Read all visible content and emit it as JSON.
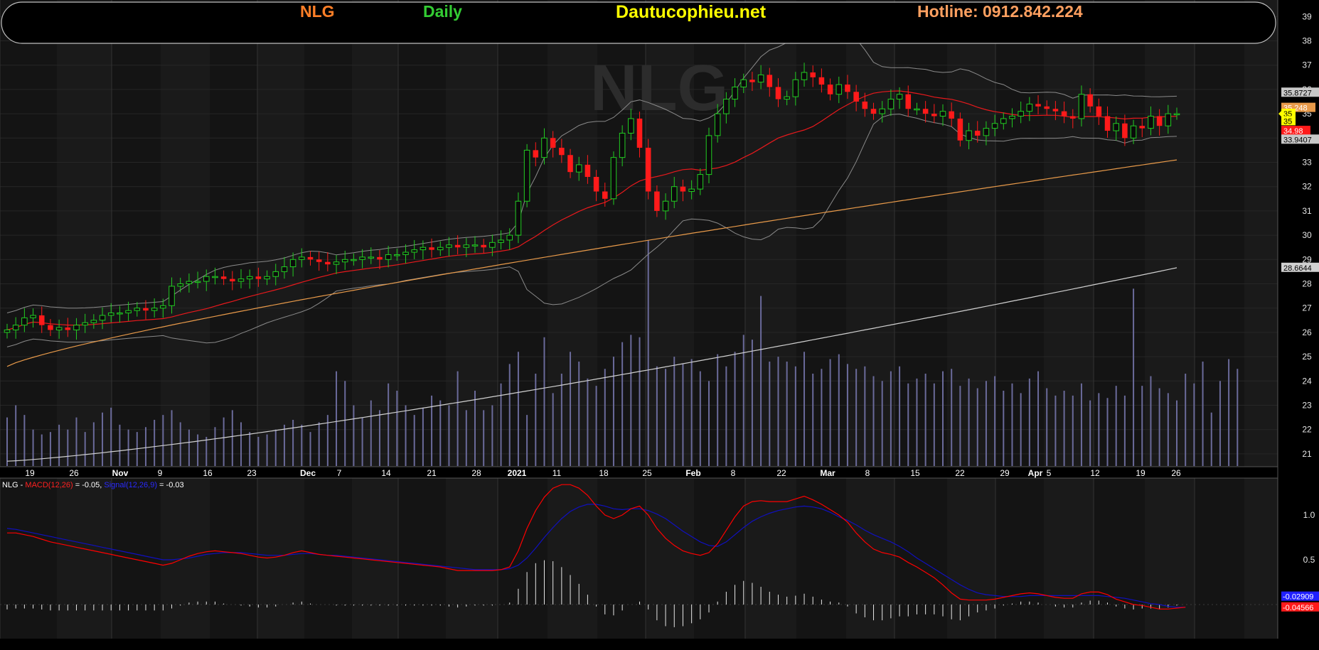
{
  "header": {
    "symbol": "NLG",
    "period": "Daily",
    "site": "Dautucophieu.net",
    "hotline": "Hotline: 0912.842.224"
  },
  "colors": {
    "symbol": "#ff7f27",
    "period": "#33cc33",
    "site": "#ffff00",
    "hotline": "#ffa060",
    "up_candle": "#22cc22",
    "down_candle": "#ff1a1a",
    "ma20": "#e8191c",
    "ma50": "#e89a4a",
    "ma200": "#d0d0d0",
    "bollinger": "#8a8a8a",
    "volume": "#6a6a9a",
    "macd": "#ff0000",
    "signal": "#1010c0",
    "histogram": "#e6e6e6"
  },
  "watermark": "NLG",
  "chart_data": [
    {
      "type": "candlestick",
      "title": "NLG Daily",
      "ylim": [
        20.4,
        39.5
      ],
      "y_ticks": [
        "21",
        "22",
        "23",
        "24",
        "25",
        "26",
        "27",
        "28",
        "29",
        "30",
        "31",
        "32",
        "33",
        "34",
        "35",
        "36",
        "37",
        "38",
        "39"
      ],
      "x_tick_labels": [
        "19",
        "26",
        "Nov",
        "9",
        "16",
        "23",
        "Dec",
        "7",
        "14",
        "21",
        "28",
        "2021",
        "11",
        "18",
        "25",
        "Feb",
        "8",
        "22",
        "Mar",
        "8",
        "15",
        "22",
        "29",
        "Apr",
        "5",
        "12",
        "19",
        "26"
      ],
      "bold_tick_labels": [
        "Nov",
        "Dec",
        "2021",
        "Feb",
        "Mar",
        "Apr"
      ],
      "close": [
        26.1,
        26.3,
        26.6,
        26.7,
        26.3,
        26.1,
        26.2,
        26.1,
        26.3,
        26.4,
        26.5,
        26.7,
        26.8,
        26.8,
        26.9,
        27.0,
        26.9,
        27.0,
        27.1,
        27.9,
        28.0,
        28.1,
        28.1,
        28.3,
        28.3,
        28.2,
        28.1,
        28.2,
        28.3,
        28.2,
        28.3,
        28.5,
        28.7,
        29.0,
        29.1,
        29.0,
        28.9,
        28.8,
        28.9,
        29.0,
        29.0,
        29.1,
        29.1,
        29.0,
        29.2,
        29.2,
        29.3,
        29.4,
        29.5,
        29.4,
        29.5,
        29.6,
        29.5,
        29.6,
        29.6,
        29.5,
        29.7,
        29.8,
        30.0,
        31.4,
        33.5,
        33.2,
        34.0,
        33.6,
        33.3,
        32.6,
        32.9,
        32.4,
        31.8,
        31.5,
        33.2,
        34.2,
        34.8,
        33.6,
        31.8,
        31.0,
        31.4,
        32.0,
        31.8,
        31.9,
        32.5,
        34.1,
        35.0,
        35.6,
        36.1,
        36.4,
        36.3,
        36.6,
        36.1,
        35.6,
        35.7,
        36.4,
        36.7,
        36.5,
        36.2,
        35.8,
        36.2,
        35.9,
        35.5,
        35.2,
        35.0,
        35.2,
        35.6,
        35.8,
        35.2,
        35.2,
        35.0,
        34.9,
        35.1,
        34.8,
        33.9,
        34.3,
        34.1,
        34.4,
        34.6,
        34.8,
        34.9,
        35.1,
        35.4,
        35.3,
        35.2,
        35.1,
        34.9,
        34.8,
        35.8,
        35.3,
        34.9,
        34.3,
        34.6,
        34.0,
        34.5,
        34.4,
        34.9,
        34.5,
        35.0,
        35.0
      ],
      "volume": [
        22.5,
        23.0,
        22.6,
        22.0,
        21.8,
        21.9,
        22.2,
        22.0,
        22.5,
        21.9,
        22.3,
        22.7,
        22.9,
        22.2,
        22.0,
        21.9,
        22.1,
        22.4,
        22.6,
        22.8,
        22.3,
        22.0,
        21.8,
        21.7,
        22.1,
        22.5,
        22.8,
        22.3,
        21.9,
        21.7,
        21.8,
        22.0,
        22.2,
        22.4,
        22.2,
        21.9,
        22.3,
        22.6,
        24.4,
        24.0,
        23.0,
        22.5,
        23.2,
        22.8,
        23.9,
        23.6,
        23.0,
        22.6,
        22.9,
        23.4,
        23.2,
        23.0,
        24.4,
        22.8,
        23.6,
        22.8,
        23.0,
        23.9,
        24.7,
        25.2,
        22.6,
        24.3,
        25.8,
        23.5,
        24.3,
        25.2,
        24.8,
        24.1,
        23.8,
        24.5,
        25.0,
        25.6,
        25.9,
        25.8,
        29.8,
        24.6,
        24.5,
        25.0,
        24.7,
        24.9,
        24.4,
        24.0,
        25.1,
        24.6,
        25.2,
        25.9,
        25.7,
        27.5,
        24.8,
        25.0,
        24.8,
        24.6,
        25.2,
        24.3,
        24.5,
        24.9,
        25.1,
        24.7,
        24.5,
        24.6,
        24.2,
        24.0,
        24.4,
        24.6,
        23.9,
        24.1,
        24.3,
        23.9,
        24.4,
        24.5,
        23.8,
        24.1,
        23.7,
        24.0,
        24.2,
        23.6,
        23.9,
        23.5,
        24.1,
        24.4,
        23.7,
        23.4,
        23.6,
        23.4,
        23.9,
        23.2,
        23.5,
        23.3,
        23.8,
        23.4,
        27.8,
        23.8,
        24.2,
        23.7,
        23.5,
        23.2,
        24.3,
        23.9,
        24.8,
        22.7,
        24.0,
        24.9,
        24.5
      ]
    },
    {
      "type": "line",
      "title": "MACD",
      "legend_prefix": "NLG - ",
      "legend_macd": "MACD(12,26)",
      "legend_macd_value": " = -0.05, ",
      "legend_signal": "Signal(12,26,9)",
      "legend_signal_value": " = -0.03",
      "ylim": [
        -0.3,
        1.5
      ],
      "y_ticks": [
        "1.0",
        "0.5"
      ],
      "macd_label": "-0.02909",
      "signal_label": "-0.04566",
      "macd": [
        0.8,
        0.8,
        0.78,
        0.76,
        0.73,
        0.7,
        0.68,
        0.66,
        0.64,
        0.62,
        0.6,
        0.58,
        0.56,
        0.54,
        0.52,
        0.5,
        0.48,
        0.46,
        0.44,
        0.46,
        0.5,
        0.54,
        0.57,
        0.59,
        0.6,
        0.59,
        0.58,
        0.57,
        0.55,
        0.53,
        0.52,
        0.53,
        0.55,
        0.58,
        0.6,
        0.58,
        0.56,
        0.55,
        0.54,
        0.53,
        0.52,
        0.51,
        0.5,
        0.49,
        0.48,
        0.47,
        0.46,
        0.45,
        0.44,
        0.43,
        0.42,
        0.4,
        0.38,
        0.38,
        0.38,
        0.38,
        0.38,
        0.39,
        0.42,
        0.6,
        0.85,
        1.05,
        1.2,
        1.3,
        1.34,
        1.34,
        1.3,
        1.22,
        1.1,
        1.0,
        0.96,
        1.0,
        1.07,
        1.1,
        1.0,
        0.85,
        0.74,
        0.66,
        0.6,
        0.57,
        0.55,
        0.58,
        0.68,
        0.83,
        0.98,
        1.1,
        1.15,
        1.16,
        1.15,
        1.15,
        1.15,
        1.18,
        1.21,
        1.17,
        1.12,
        1.06,
        1.0,
        0.92,
        0.8,
        0.7,
        0.62,
        0.58,
        0.56,
        0.53,
        0.47,
        0.42,
        0.36,
        0.3,
        0.22,
        0.13,
        0.06,
        0.05,
        0.05,
        0.05,
        0.06,
        0.08,
        0.1,
        0.12,
        0.13,
        0.12,
        0.1,
        0.08,
        0.07,
        0.07,
        0.12,
        0.14,
        0.14,
        0.11,
        0.06,
        0.03,
        0.0,
        -0.01,
        -0.03,
        -0.05,
        -0.05,
        -0.04,
        -0.03
      ],
      "signal": [
        0.85,
        0.84,
        0.82,
        0.8,
        0.78,
        0.76,
        0.74,
        0.72,
        0.7,
        0.68,
        0.66,
        0.64,
        0.62,
        0.6,
        0.58,
        0.56,
        0.54,
        0.52,
        0.5,
        0.5,
        0.51,
        0.52,
        0.54,
        0.56,
        0.57,
        0.58,
        0.58,
        0.58,
        0.57,
        0.56,
        0.55,
        0.55,
        0.55,
        0.56,
        0.57,
        0.57,
        0.56,
        0.55,
        0.55,
        0.54,
        0.53,
        0.52,
        0.51,
        0.5,
        0.49,
        0.48,
        0.47,
        0.46,
        0.45,
        0.44,
        0.43,
        0.42,
        0.41,
        0.4,
        0.39,
        0.39,
        0.39,
        0.39,
        0.4,
        0.44,
        0.52,
        0.63,
        0.75,
        0.86,
        0.96,
        1.04,
        1.09,
        1.12,
        1.12,
        1.1,
        1.07,
        1.06,
        1.07,
        1.07,
        1.05,
        1.01,
        0.96,
        0.89,
        0.82,
        0.76,
        0.7,
        0.66,
        0.65,
        0.7,
        0.78,
        0.86,
        0.93,
        0.98,
        1.02,
        1.05,
        1.07,
        1.09,
        1.1,
        1.09,
        1.07,
        1.03,
        0.98,
        0.94,
        0.89,
        0.83,
        0.78,
        0.74,
        0.7,
        0.65,
        0.59,
        0.52,
        0.46,
        0.4,
        0.34,
        0.28,
        0.22,
        0.17,
        0.13,
        0.11,
        0.1,
        0.09,
        0.09,
        0.09,
        0.1,
        0.1,
        0.1,
        0.1,
        0.1,
        0.1,
        0.1,
        0.1,
        0.1,
        0.09,
        0.08,
        0.07,
        0.05,
        0.03,
        0.01,
        0.0,
        -0.02,
        -0.03,
        -0.03
      ]
    }
  ],
  "price_labels": [
    {
      "text": "35.8727",
      "value": 35.8727,
      "bg": "#c8c8c8",
      "fg": "#000000"
    },
    {
      "text": "35.248",
      "value": 35.248,
      "bg": "#e89a4a",
      "fg": "#ffffff"
    },
    {
      "text": "35",
      "value": 35.0,
      "bg": "#ffff00",
      "fg": "#000000"
    },
    {
      "text": "35",
      "value": 34.7,
      "bg": "#ffff00",
      "fg": "#000000"
    },
    {
      "text": "34.98",
      "value": 34.3,
      "bg": "#ff1a1a",
      "fg": "#ffffff"
    },
    {
      "text": "33.9407",
      "value": 33.9407,
      "bg": "#c8c8c8",
      "fg": "#000000"
    },
    {
      "text": "28.6644",
      "value": 28.6644,
      "bg": "#d0d0d0",
      "fg": "#000000"
    }
  ]
}
